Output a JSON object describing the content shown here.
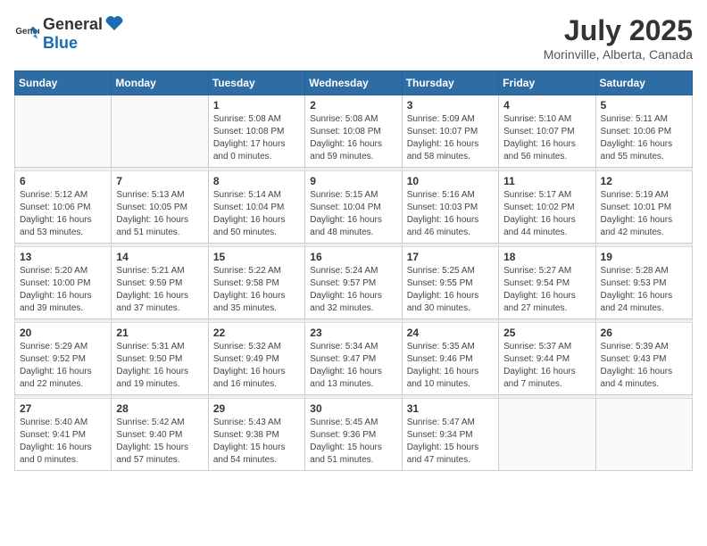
{
  "logo": {
    "general": "General",
    "blue": "Blue"
  },
  "title": "July 2025",
  "subtitle": "Morinville, Alberta, Canada",
  "days_of_week": [
    "Sunday",
    "Monday",
    "Tuesday",
    "Wednesday",
    "Thursday",
    "Friday",
    "Saturday"
  ],
  "weeks": [
    [
      {
        "day": "",
        "info": ""
      },
      {
        "day": "",
        "info": ""
      },
      {
        "day": "1",
        "info": "Sunrise: 5:08 AM\nSunset: 10:08 PM\nDaylight: 17 hours\nand 0 minutes."
      },
      {
        "day": "2",
        "info": "Sunrise: 5:08 AM\nSunset: 10:08 PM\nDaylight: 16 hours\nand 59 minutes."
      },
      {
        "day": "3",
        "info": "Sunrise: 5:09 AM\nSunset: 10:07 PM\nDaylight: 16 hours\nand 58 minutes."
      },
      {
        "day": "4",
        "info": "Sunrise: 5:10 AM\nSunset: 10:07 PM\nDaylight: 16 hours\nand 56 minutes."
      },
      {
        "day": "5",
        "info": "Sunrise: 5:11 AM\nSunset: 10:06 PM\nDaylight: 16 hours\nand 55 minutes."
      }
    ],
    [
      {
        "day": "6",
        "info": "Sunrise: 5:12 AM\nSunset: 10:06 PM\nDaylight: 16 hours\nand 53 minutes."
      },
      {
        "day": "7",
        "info": "Sunrise: 5:13 AM\nSunset: 10:05 PM\nDaylight: 16 hours\nand 51 minutes."
      },
      {
        "day": "8",
        "info": "Sunrise: 5:14 AM\nSunset: 10:04 PM\nDaylight: 16 hours\nand 50 minutes."
      },
      {
        "day": "9",
        "info": "Sunrise: 5:15 AM\nSunset: 10:04 PM\nDaylight: 16 hours\nand 48 minutes."
      },
      {
        "day": "10",
        "info": "Sunrise: 5:16 AM\nSunset: 10:03 PM\nDaylight: 16 hours\nand 46 minutes."
      },
      {
        "day": "11",
        "info": "Sunrise: 5:17 AM\nSunset: 10:02 PM\nDaylight: 16 hours\nand 44 minutes."
      },
      {
        "day": "12",
        "info": "Sunrise: 5:19 AM\nSunset: 10:01 PM\nDaylight: 16 hours\nand 42 minutes."
      }
    ],
    [
      {
        "day": "13",
        "info": "Sunrise: 5:20 AM\nSunset: 10:00 PM\nDaylight: 16 hours\nand 39 minutes."
      },
      {
        "day": "14",
        "info": "Sunrise: 5:21 AM\nSunset: 9:59 PM\nDaylight: 16 hours\nand 37 minutes."
      },
      {
        "day": "15",
        "info": "Sunrise: 5:22 AM\nSunset: 9:58 PM\nDaylight: 16 hours\nand 35 minutes."
      },
      {
        "day": "16",
        "info": "Sunrise: 5:24 AM\nSunset: 9:57 PM\nDaylight: 16 hours\nand 32 minutes."
      },
      {
        "day": "17",
        "info": "Sunrise: 5:25 AM\nSunset: 9:55 PM\nDaylight: 16 hours\nand 30 minutes."
      },
      {
        "day": "18",
        "info": "Sunrise: 5:27 AM\nSunset: 9:54 PM\nDaylight: 16 hours\nand 27 minutes."
      },
      {
        "day": "19",
        "info": "Sunrise: 5:28 AM\nSunset: 9:53 PM\nDaylight: 16 hours\nand 24 minutes."
      }
    ],
    [
      {
        "day": "20",
        "info": "Sunrise: 5:29 AM\nSunset: 9:52 PM\nDaylight: 16 hours\nand 22 minutes."
      },
      {
        "day": "21",
        "info": "Sunrise: 5:31 AM\nSunset: 9:50 PM\nDaylight: 16 hours\nand 19 minutes."
      },
      {
        "day": "22",
        "info": "Sunrise: 5:32 AM\nSunset: 9:49 PM\nDaylight: 16 hours\nand 16 minutes."
      },
      {
        "day": "23",
        "info": "Sunrise: 5:34 AM\nSunset: 9:47 PM\nDaylight: 16 hours\nand 13 minutes."
      },
      {
        "day": "24",
        "info": "Sunrise: 5:35 AM\nSunset: 9:46 PM\nDaylight: 16 hours\nand 10 minutes."
      },
      {
        "day": "25",
        "info": "Sunrise: 5:37 AM\nSunset: 9:44 PM\nDaylight: 16 hours\nand 7 minutes."
      },
      {
        "day": "26",
        "info": "Sunrise: 5:39 AM\nSunset: 9:43 PM\nDaylight: 16 hours\nand 4 minutes."
      }
    ],
    [
      {
        "day": "27",
        "info": "Sunrise: 5:40 AM\nSunset: 9:41 PM\nDaylight: 16 hours\nand 0 minutes."
      },
      {
        "day": "28",
        "info": "Sunrise: 5:42 AM\nSunset: 9:40 PM\nDaylight: 15 hours\nand 57 minutes."
      },
      {
        "day": "29",
        "info": "Sunrise: 5:43 AM\nSunset: 9:38 PM\nDaylight: 15 hours\nand 54 minutes."
      },
      {
        "day": "30",
        "info": "Sunrise: 5:45 AM\nSunset: 9:36 PM\nDaylight: 15 hours\nand 51 minutes."
      },
      {
        "day": "31",
        "info": "Sunrise: 5:47 AM\nSunset: 9:34 PM\nDaylight: 15 hours\nand 47 minutes."
      },
      {
        "day": "",
        "info": ""
      },
      {
        "day": "",
        "info": ""
      }
    ]
  ]
}
